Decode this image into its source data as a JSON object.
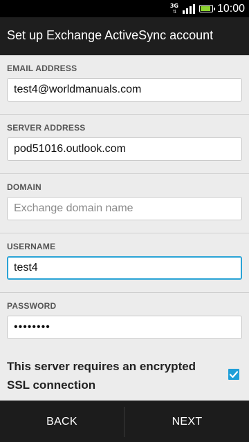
{
  "status_bar": {
    "network_type": "3G",
    "time": "10:00",
    "signal_bars": 4,
    "battery_level": 0.9,
    "battery_color": "#8bd22e"
  },
  "header": {
    "title": "Set up Exchange ActiveSync account"
  },
  "form": {
    "email": {
      "label": "EMAIL ADDRESS",
      "value": "test4@worldmanuals.com"
    },
    "server": {
      "label": "SERVER ADDRESS",
      "value": "pod51016.outlook.com"
    },
    "domain": {
      "label": "DOMAIN",
      "value": "",
      "placeholder": "Exchange domain name"
    },
    "username": {
      "label": "USERNAME",
      "value": "test4"
    },
    "password": {
      "label": "PASSWORD",
      "value": "••••••••"
    }
  },
  "ssl": {
    "label": "This server requires an encrypted SSL connection",
    "checked": true
  },
  "buttons": {
    "back": "BACK",
    "next": "NEXT"
  },
  "colors": {
    "accent": "#1f9fd8",
    "focus": "#2aa3d6"
  }
}
